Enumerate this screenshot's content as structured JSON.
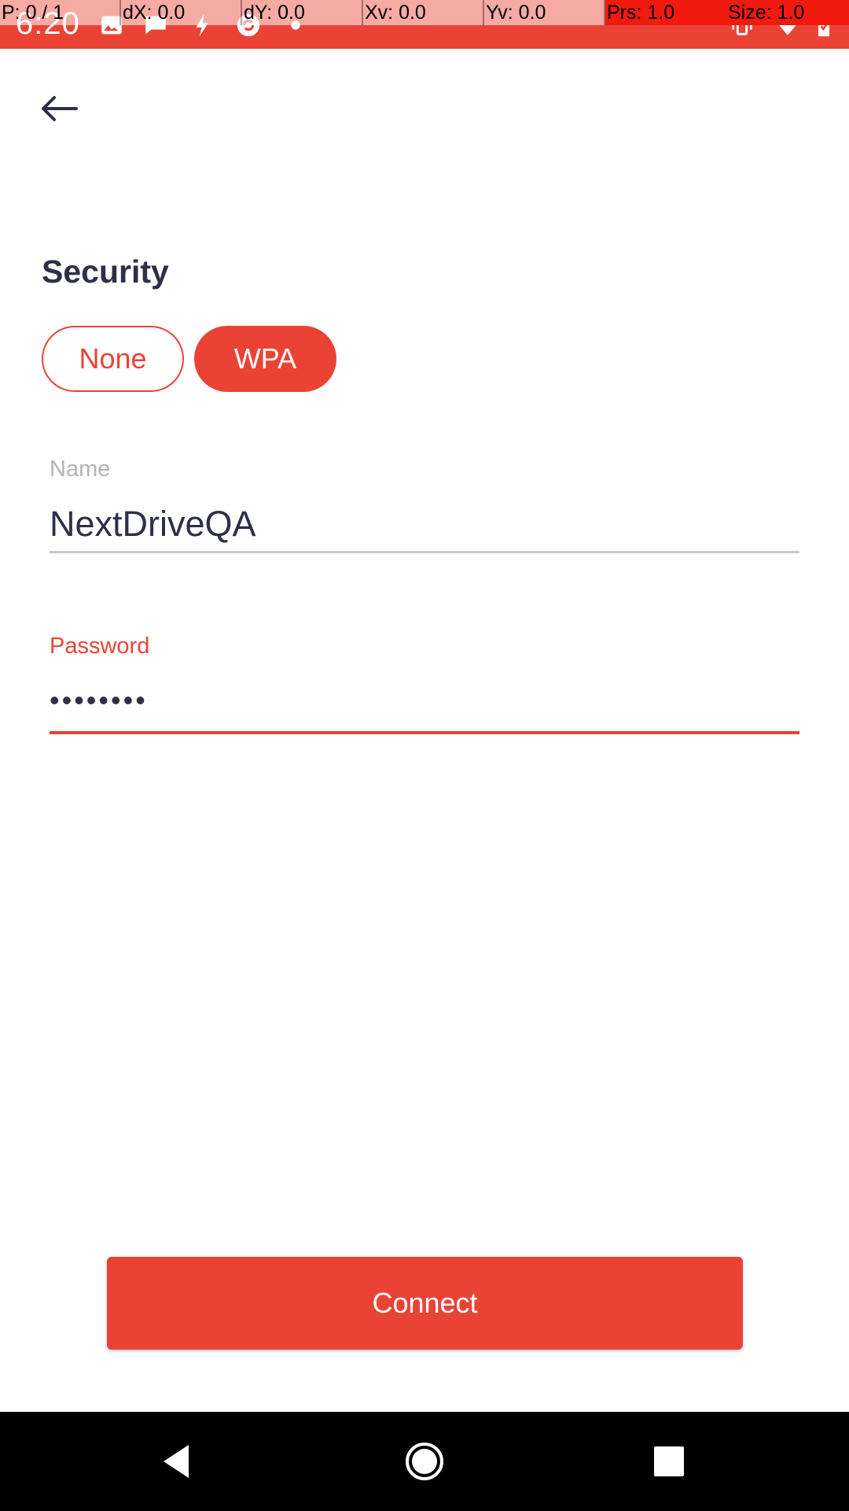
{
  "status_bar": {
    "time": "6:20",
    "icons": [
      "image-icon",
      "chat-icon",
      "flash-icon",
      "sync-icon",
      "dot-icon",
      "vibrate-icon",
      "wifi-icon",
      "battery-icon"
    ]
  },
  "debug_overlay": {
    "pointer": "P: 0 / 1",
    "dx": "dX: 0.0",
    "dy": "dY: 0.0",
    "xv": "Xv: 0.0",
    "yv": "Yv: 0.0",
    "prs": "Prs: 1.0",
    "size": "Size: 1.0"
  },
  "header": {
    "back_icon": "arrow-left-icon"
  },
  "security": {
    "title": "Security",
    "options": [
      {
        "label": "None",
        "selected": false
      },
      {
        "label": "WPA",
        "selected": true
      }
    ]
  },
  "form": {
    "name_label": "Name",
    "name_value": "NextDriveQA",
    "password_label": "Password",
    "password_value": "••••••••"
  },
  "actions": {
    "connect_label": "Connect"
  },
  "colors": {
    "accent": "#ea4335",
    "text_dark": "#2d3047",
    "label_gray": "#b3b3b8"
  },
  "nav_bar": {
    "icons": [
      "back-triangle-icon",
      "home-circle-icon",
      "recents-square-icon"
    ]
  }
}
